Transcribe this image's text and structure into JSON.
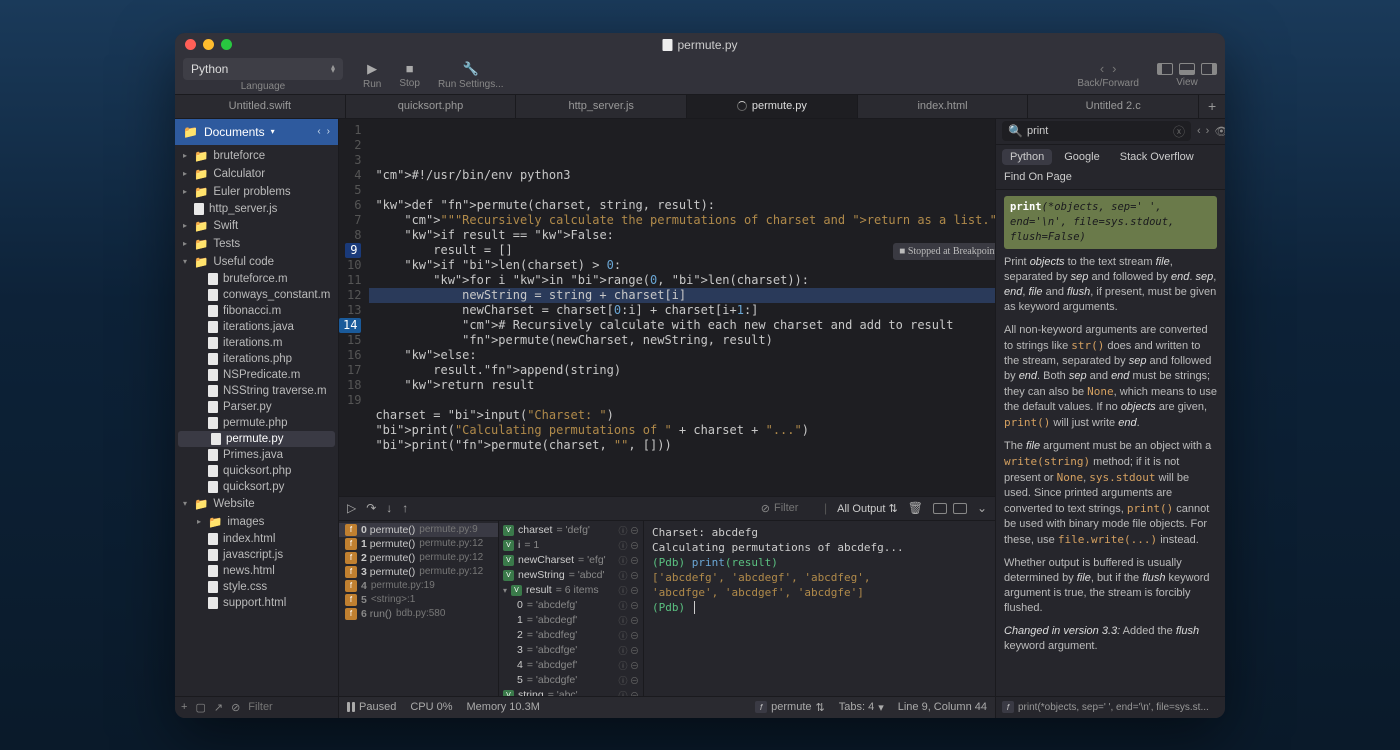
{
  "window": {
    "title": "permute.py"
  },
  "toolbar": {
    "language": "Python",
    "language_label": "Language",
    "run": "Run",
    "stop": "Stop",
    "settings": "Run Settings...",
    "back_forward": "Back/Forward",
    "view": "View"
  },
  "tabs": [
    {
      "label": "Untitled.swift"
    },
    {
      "label": "quicksort.php"
    },
    {
      "label": "http_server.js"
    },
    {
      "label": "permute.py",
      "active": true,
      "busy": true
    },
    {
      "label": "index.html"
    },
    {
      "label": "Untitled 2.c"
    }
  ],
  "sidebar": {
    "root": "Documents",
    "tree": [
      {
        "type": "folder",
        "name": "bruteforce",
        "depth": 0,
        "expanded": false
      },
      {
        "type": "folder",
        "name": "Calculator",
        "depth": 0,
        "expanded": false
      },
      {
        "type": "folder",
        "name": "Euler problems",
        "depth": 0,
        "expanded": false
      },
      {
        "type": "file",
        "name": "http_server.js",
        "depth": 0
      },
      {
        "type": "folder",
        "name": "Swift",
        "depth": 0,
        "expanded": false
      },
      {
        "type": "folder",
        "name": "Tests",
        "depth": 0,
        "expanded": false
      },
      {
        "type": "folder",
        "name": "Useful code",
        "depth": 0,
        "expanded": true
      },
      {
        "type": "file",
        "name": "bruteforce.m",
        "depth": 1
      },
      {
        "type": "file",
        "name": "conways_constant.m",
        "depth": 1
      },
      {
        "type": "file",
        "name": "fibonacci.m",
        "depth": 1
      },
      {
        "type": "file",
        "name": "iterations.java",
        "depth": 1
      },
      {
        "type": "file",
        "name": "iterations.m",
        "depth": 1
      },
      {
        "type": "file",
        "name": "iterations.php",
        "depth": 1
      },
      {
        "type": "file",
        "name": "NSPredicate.m",
        "depth": 1
      },
      {
        "type": "file",
        "name": "NSString traverse.m",
        "depth": 1
      },
      {
        "type": "file",
        "name": "Parser.py",
        "depth": 1
      },
      {
        "type": "file",
        "name": "permute.php",
        "depth": 1
      },
      {
        "type": "file",
        "name": "permute.py",
        "depth": 1,
        "selected": true
      },
      {
        "type": "file",
        "name": "Primes.java",
        "depth": 1
      },
      {
        "type": "file",
        "name": "quicksort.php",
        "depth": 1
      },
      {
        "type": "file",
        "name": "quicksort.py",
        "depth": 1
      },
      {
        "type": "folder",
        "name": "Website",
        "depth": 0,
        "expanded": true
      },
      {
        "type": "folder",
        "name": "images",
        "depth": 1,
        "expanded": false
      },
      {
        "type": "file",
        "name": "index.html",
        "depth": 1
      },
      {
        "type": "file",
        "name": "javascript.js",
        "depth": 1
      },
      {
        "type": "file",
        "name": "news.html",
        "depth": 1
      },
      {
        "type": "file",
        "name": "style.css",
        "depth": 1
      },
      {
        "type": "file",
        "name": "support.html",
        "depth": 1
      }
    ],
    "filter_placeholder": "Filter"
  },
  "editor": {
    "breakpoints": [
      9,
      14
    ],
    "active_line": 9,
    "bp_badge": "Stopped at Breakpoint",
    "lines": [
      "#!/usr/bin/env python3",
      "",
      "def permute(charset, string, result):",
      "    \"\"\"Recursively calculate the permutations of charset and return as a list.\"\"\"",
      "    if result == False:",
      "        result = []",
      "    if len(charset) > 0:",
      "        for i in range(0, len(charset)):",
      "            newString = string + charset[i]",
      "            newCharset = charset[0:i] + charset[i+1:]",
      "            # Recursively calculate with each new charset and add to result",
      "            permute(newCharset, newString, result)",
      "    else:",
      "        result.append(string)",
      "    return result",
      "",
      "charset = input(\"Charset: \")",
      "print(\"Calculating permutations of \" + charset + \"...\")",
      "print(permute(charset, \"\", []))"
    ]
  },
  "debug": {
    "filter_placeholder": "Filter",
    "output_mode": "All Output",
    "stack": [
      {
        "n": "0",
        "fn": "permute()",
        "loc": "permute.py:9",
        "sel": true
      },
      {
        "n": "1",
        "fn": "permute()",
        "loc": "permute.py:12"
      },
      {
        "n": "2",
        "fn": "permute()",
        "loc": "permute.py:12"
      },
      {
        "n": "3",
        "fn": "permute()",
        "loc": "permute.py:12"
      },
      {
        "n": "4",
        "fn": "",
        "loc": "permute.py:19",
        "dim": true
      },
      {
        "n": "5",
        "fn": "",
        "loc": "<string>:1",
        "dim": true
      },
      {
        "n": "6",
        "fn": "run()",
        "loc": "bdb.py:580",
        "dim": true
      }
    ],
    "vars": [
      {
        "name": "charset",
        "val": "= 'defg'"
      },
      {
        "name": "i",
        "val": "= 1"
      },
      {
        "name": "newCharset",
        "val": "= 'efg'"
      },
      {
        "name": "newString",
        "val": "= 'abcd'"
      },
      {
        "name": "result",
        "val": "= 6 items",
        "expandable": true,
        "expanded": true
      },
      {
        "name": "0",
        "val": "= 'abcdefg'",
        "child": true
      },
      {
        "name": "1",
        "val": "= 'abcdegf'",
        "child": true
      },
      {
        "name": "2",
        "val": "= 'abcdfeg'",
        "child": true
      },
      {
        "name": "3",
        "val": "= 'abcdfge'",
        "child": true
      },
      {
        "name": "4",
        "val": "= 'abcdgef'",
        "child": true
      },
      {
        "name": "5",
        "val": "= 'abcdgfe'",
        "child": true
      },
      {
        "name": "string",
        "val": "= 'abc'"
      }
    ],
    "console": [
      {
        "cls": "out",
        "text": "Charset: abcdefg"
      },
      {
        "cls": "out",
        "text": "Calculating permutations of abcdefg..."
      },
      {
        "cls": "pdb",
        "text": "(Pdb) print(result)"
      },
      {
        "cls": "list",
        "text": "['abcdefg', 'abcdegf', 'abcdfeg',"
      },
      {
        "cls": "list",
        "text": " 'abcdfge', 'abcdgef', 'abcdgfe']"
      },
      {
        "cls": "pdb",
        "text": "(Pdb) "
      }
    ]
  },
  "status": {
    "paused": "Paused",
    "cpu": "CPU 0%",
    "memory": "Memory 10.3M",
    "symbol": "permute",
    "tabs": "Tabs: 4",
    "cursor": "Line 9, Column 44",
    "doc_sig": "print(*objects, sep=' ', end='\\n', file=sys.st..."
  },
  "docs": {
    "search_value": "print",
    "tabs": [
      "Python",
      "Google",
      "Stack Overflow"
    ],
    "active_tab": 0,
    "find_on_page": "Find On Page",
    "signature": "print(*objects, sep=' ', end='\\n', file=sys.stdout, flush=False)",
    "sig_bold": "print",
    "paras": [
      "Print <em>objects</em> to the text stream <em>file</em>, separated by <em>sep</em> and followed by <em>end</em>. <em>sep</em>, <em>end</em>, <em>file</em> and <em>flush</em>, if present, must be given as keyword arguments.",
      "All non-keyword arguments are converted to strings like <code>str()</code> does and written to the stream, separated by <em>sep</em> and followed by <em>end</em>. Both <em>sep</em> and <em>end</em> must be strings; they can also be <code>None</code>, which means to use the default values. If no <em>objects</em> are given, <code>print()</code> will just write <em>end</em>.",
      "The <em>file</em> argument must be an object with a <code>write(string)</code> method; if it is not present or <code>None</code>, <code>sys.stdout</code> will be used. Since printed arguments are converted to text strings, <code>print()</code> cannot be used with binary mode file objects. For these, use <code>file.write(...)</code> instead.",
      "Whether output is buffered is usually determined by <em>file</em>, but if the <em>flush</em> keyword argument is true, the stream is forcibly flushed.",
      "<em>Changed in version 3.3:</em> Added the <em>flush</em> keyword argument."
    ]
  }
}
